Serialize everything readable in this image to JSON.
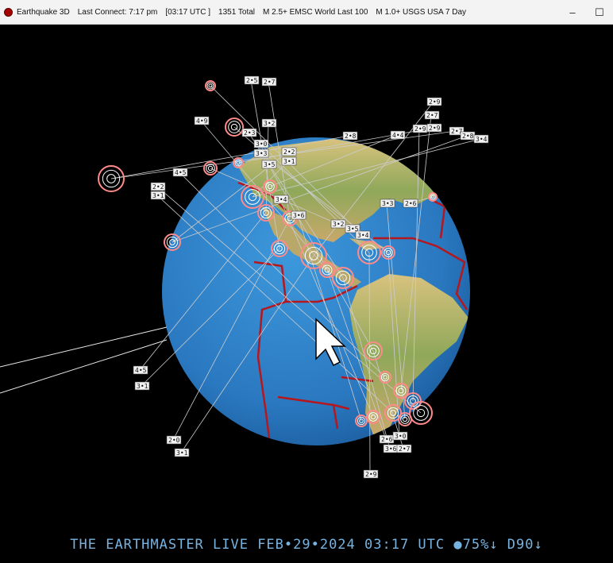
{
  "window": {
    "app_title": "Earthquake 3D",
    "last_connect": "Last Connect: 7:17 pm",
    "utc_time": "[03:17 UTC ]",
    "total": "1351  Total",
    "feed_emsc": "M 2.5+  EMSC World Last 100",
    "feed_usgs": "M 1.0+  USGS USA 7 Day",
    "minimize_glyph": "–",
    "maximize_glyph": "☐"
  },
  "status_bar": {
    "text": "THE EARTHMASTER LIVE FEB•29•2024 03:17 UTC ●75%↓ D90↓"
  },
  "colors": {
    "ocean": "#2a7ec8",
    "land": "#c9b27a",
    "plate_boundary": "#b5171e",
    "quake_ring": "#ff8a8a",
    "status_text": "#78b3e0"
  },
  "quake_labels": [
    "2•8",
    "2•2",
    "3•1",
    "3•2",
    "2•5",
    "2•7",
    "2•9",
    "4•9",
    "2•3",
    "3•0",
    "3•3",
    "3•5",
    "4•5",
    "2•7",
    "2•9",
    "2•2",
    "3•1",
    "3•4",
    "3•6",
    "3•3",
    "2•6",
    "3•2",
    "3•5",
    "3•4",
    "2•9",
    "4•4",
    "2•7",
    "2•8",
    "3•4",
    "4•5",
    "3•1",
    "2•0",
    "3•1",
    "2•6",
    "3•6",
    "2•9",
    "3•0",
    "2•7"
  ],
  "cursor_icon": "mouse-pointer-icon"
}
